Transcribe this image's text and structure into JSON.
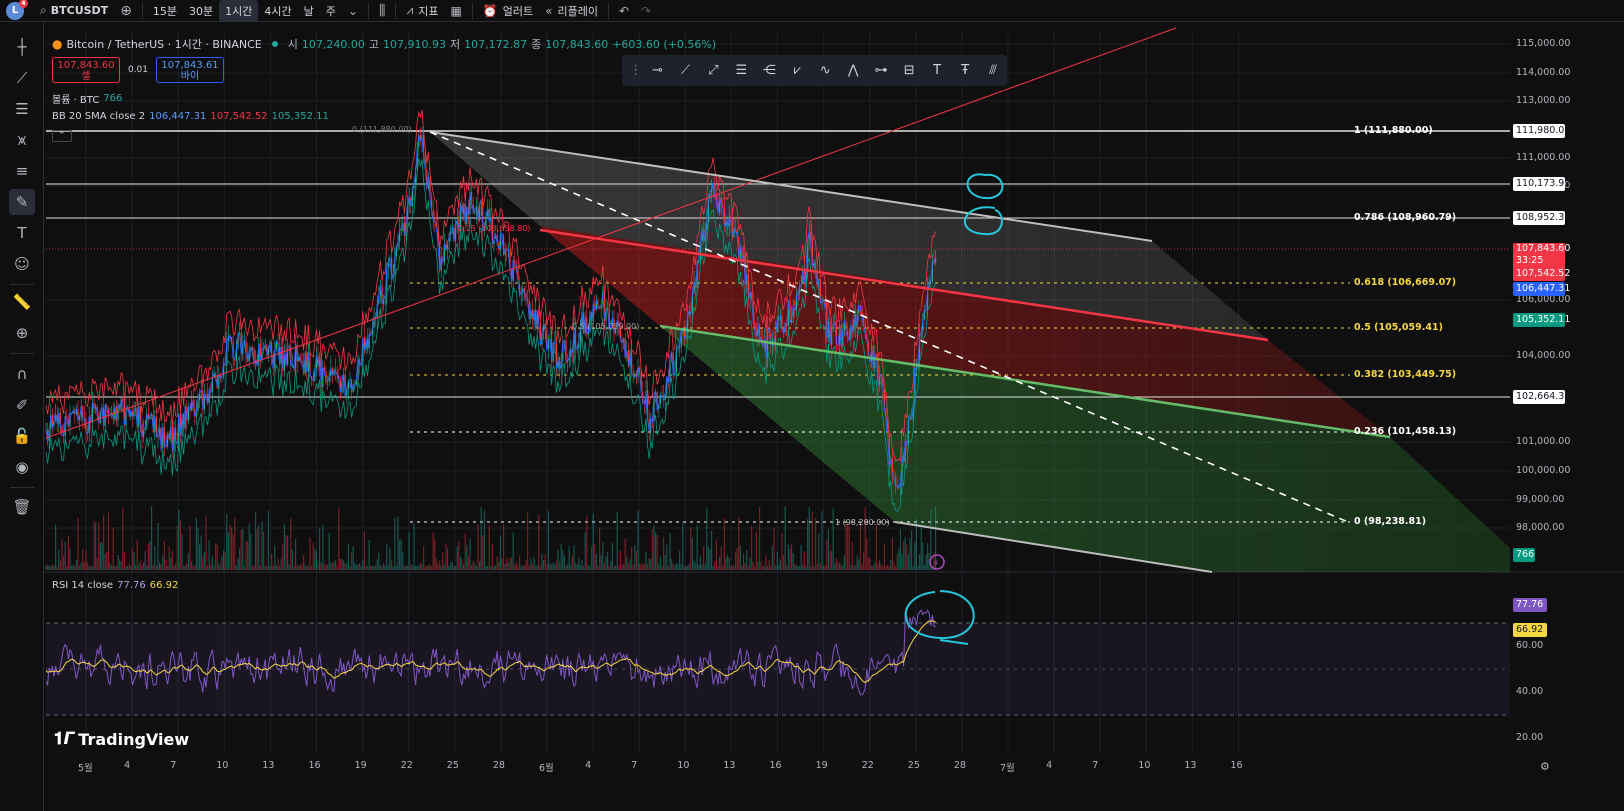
{
  "toolbar": {
    "avatar_letter": "L",
    "notification_count": "4",
    "symbol": "BTCUSDT",
    "intervals": [
      "15분",
      "30분",
      "1시간",
      "4시간",
      "날",
      "주"
    ],
    "active_interval": "1시간",
    "indicators_label": "지표",
    "alert_label": "얼러트",
    "replay_label": "리플레이"
  },
  "legend": {
    "title": "Bitcoin / TetherUS · 1시간 · BINANCE",
    "open_label": "시",
    "open": "107,240.00",
    "high_label": "고",
    "high": "107,910.93",
    "low_label": "저",
    "low": "107,172.87",
    "close_label": "종",
    "close": "107,843.60",
    "change": "+603.60 (+0.56%)",
    "sell_price": "107,843.60",
    "sell_label": "셀",
    "spread": "0.01",
    "buy_price": "107,843.61",
    "buy_label": "바이",
    "volume_label": "볼륨 · BTC",
    "volume_value": "766",
    "bb_label": "BB 20 SMA close 2",
    "bb_basis": "106,447.31",
    "bb_upper": "107,542.52",
    "bb_lower": "105,352.11"
  },
  "rsi": {
    "label": "RSI 14 close",
    "value": "77.76",
    "ma_value": "66.92",
    "axis": [
      "60.00",
      "40.00",
      "20.00"
    ]
  },
  "price_axis": [
    "115,000.00",
    "114,000.00",
    "113,000.00",
    "111,000.00",
    "110,000.00",
    "106,000.00",
    "104,000.00",
    "101,000.00",
    "100,000.00",
    "99,000.00",
    "98,000.00"
  ],
  "price_tags": {
    "h111980": "111,980.00",
    "h110173": "110,173.92",
    "h108952": "108,952.38",
    "last": "107,843.60",
    "countdown": "33:25",
    "bb_upper": "107,542.52",
    "bb_basis": "106,447.31",
    "bb_lower": "105,352.11",
    "h102664": "102,664.31",
    "volume": "766",
    "rsi_value": "77.76",
    "rsi_ma": "66.92"
  },
  "fib_levels": [
    {
      "label": "1 (111,880.00)",
      "color": "#ffffff"
    },
    {
      "label": "0.786 (108,960.79)",
      "color": "#ffffff"
    },
    {
      "label": "0.618 (106,669.07)",
      "color": "#f5d742"
    },
    {
      "label": "0.5 (105,059.41)",
      "color": "#f5d742"
    },
    {
      "label": "0.382 (103,449.75)",
      "color": "#f5d742"
    },
    {
      "label": "0.236 (101,458.13)",
      "color": "#ffffff"
    },
    {
      "label": "0 (98,238.81)",
      "color": "#ffffff"
    }
  ],
  "chart_annotations": {
    "left_top_fib": "0 (111,880.00)",
    "mid_fib": "0.25 (108,658.80)",
    "low_fib": "1 (98,200.00)",
    "mid_label": "0.5 (105,059.00)"
  },
  "time_axis": [
    "5월",
    "4",
    "7",
    "10",
    "13",
    "16",
    "19",
    "22",
    "25",
    "28",
    "6월",
    "4",
    "7",
    "10",
    "13",
    "16",
    "19",
    "22",
    "25",
    "28",
    "7월",
    "4",
    "7",
    "10",
    "13",
    "16"
  ],
  "brand": "TradingView",
  "colors": {
    "bg": "#0f0f0f",
    "up": "#26a69a",
    "down": "#f23645",
    "accent_blue": "#2962ff",
    "rsi_line": "#7e57c2",
    "rsi_ma": "#f5d742"
  }
}
